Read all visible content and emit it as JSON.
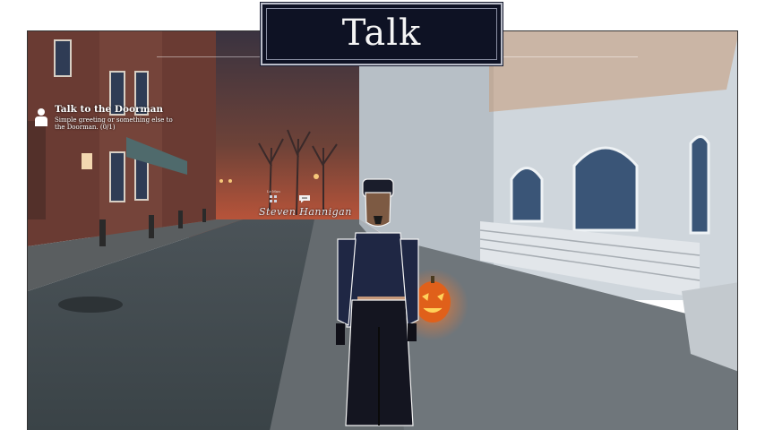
{
  "header": {
    "title": "Talk"
  },
  "quest": {
    "icon": "person-icon",
    "title": "Talk to the Doorman",
    "description": "Simple greeting or something else to the Doorman. (0/1)"
  },
  "npc": {
    "name": "Steven Hannigan",
    "small_label": "Lv.Man",
    "chat_icon": "speech-bubble-icon"
  },
  "colors": {
    "plaque_bg": "#0e1224",
    "sky_glow": "#c9583a",
    "pumpkin": "#e0601a"
  }
}
